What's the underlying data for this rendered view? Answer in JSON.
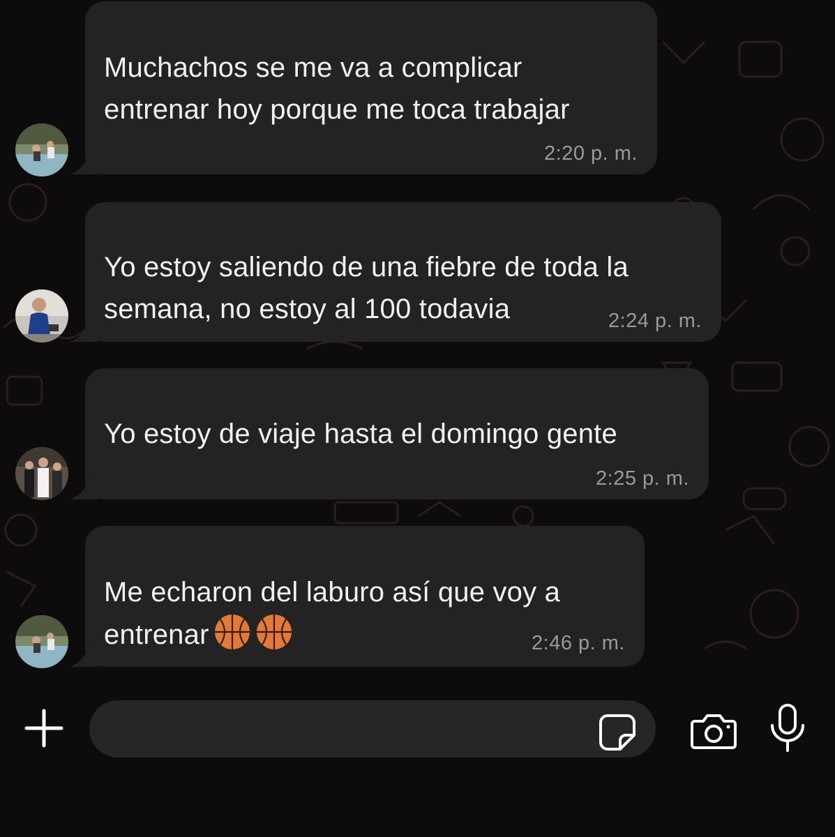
{
  "messages": [
    {
      "lines": [
        "Muchachos se me va a complicar",
        "entrenar hoy porque me toca trabajar"
      ],
      "time": "2:20 p. m.",
      "avatar": "group-photo-avatar"
    },
    {
      "lines": [
        "Yo estoy saliendo de una fiebre de toda la",
        "semana, no estoy al 100 todavia"
      ],
      "time": "2:24 p. m.",
      "avatar": "person-avatar"
    },
    {
      "lines": [
        "Yo estoy de viaje hasta el domingo gente"
      ],
      "time": "2:25 p. m.",
      "avatar": "group-photo-avatar"
    },
    {
      "lines": [
        "Me echaron del laburo así que voy a",
        "entrenar"
      ],
      "time": "2:46 p. m.",
      "avatar": "group-photo-avatar",
      "emoji": [
        "basketball-icon",
        "basketball-icon"
      ]
    }
  ],
  "composer": {
    "placeholder": "",
    "icons": [
      "plus-icon",
      "sticker-icon",
      "camera-icon",
      "microphone-icon"
    ]
  },
  "colors": {
    "background": "#0e0b0c",
    "bubble": "#232323",
    "text": "#f2f2f2",
    "timestamp": "#9a9a9a",
    "input_field": "#262626"
  }
}
